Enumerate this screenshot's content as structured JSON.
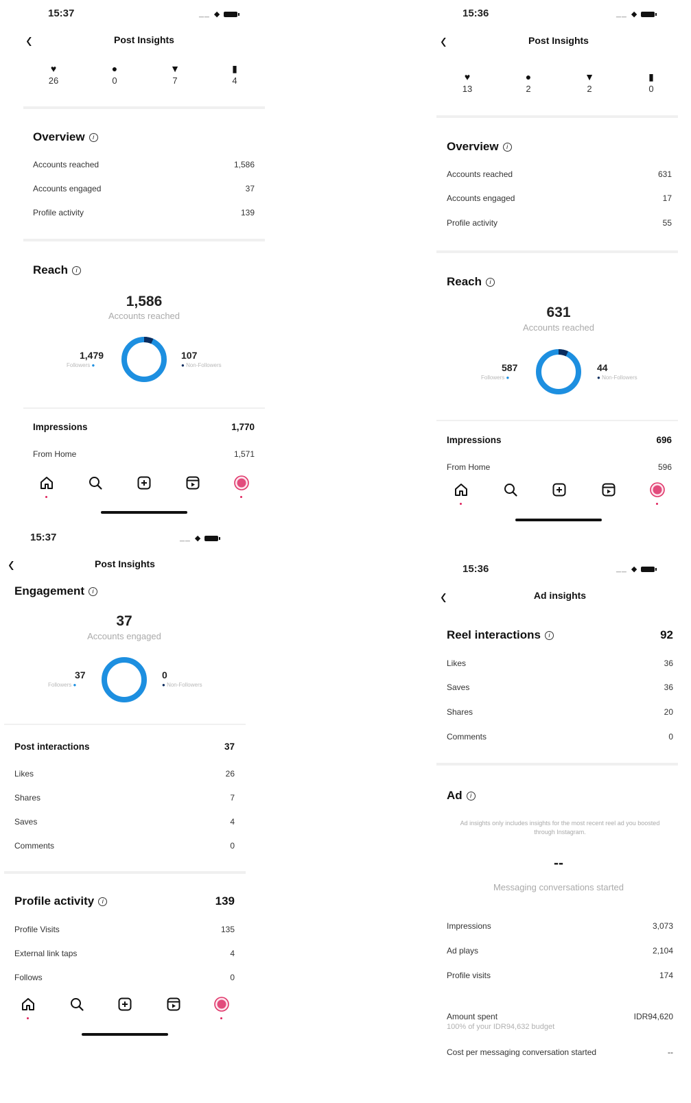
{
  "colors": {
    "accent": "#1d8fe0",
    "accent_dark": "#0c2d5e",
    "divider": "#f0f0f0"
  },
  "icons": [
    "heart-icon",
    "comment-icon",
    "share-icon",
    "bookmark-icon",
    "home-icon",
    "search-icon",
    "create-icon",
    "reels-icon",
    "avatar"
  ],
  "p1": {
    "time": "15:37",
    "title": "Post Insights",
    "stats": {
      "likes": "26",
      "comments": "0",
      "shares": "7",
      "saves": "4"
    },
    "overview": {
      "title": "Overview",
      "rows": [
        {
          "label": "Accounts reached",
          "value": "1,586"
        },
        {
          "label": "Accounts engaged",
          "value": "37"
        },
        {
          "label": "Profile activity",
          "value": "139"
        }
      ]
    },
    "reach": {
      "title": "Reach",
      "total": "1,586",
      "sub": "Accounts reached",
      "followers": "1,479",
      "followers_label": "Followers",
      "non_followers": "107",
      "non_followers_label": "Non-Followers",
      "non_follower_fraction": 0.067
    },
    "impressions": {
      "label": "Impressions",
      "value": "1,770"
    },
    "from_home": {
      "label": "From Home",
      "value": "1,571"
    }
  },
  "p2": {
    "time": "15:36",
    "title": "Post Insights",
    "stats": {
      "likes": "13",
      "comments": "2",
      "shares": "2",
      "saves": "0"
    },
    "overview": {
      "title": "Overview",
      "rows": [
        {
          "label": "Accounts reached",
          "value": "631"
        },
        {
          "label": "Accounts engaged",
          "value": "17"
        },
        {
          "label": "Profile activity",
          "value": "55"
        }
      ]
    },
    "reach": {
      "title": "Reach",
      "total": "631",
      "sub": "Accounts reached",
      "followers": "587",
      "followers_label": "Followers",
      "non_followers": "44",
      "non_followers_label": "Non-Followers",
      "non_follower_fraction": 0.07
    },
    "impressions": {
      "label": "Impressions",
      "value": "696"
    },
    "from_home": {
      "label": "From Home",
      "value": "596"
    }
  },
  "p3": {
    "time": "15:37",
    "title": "Post Insights",
    "engagement": {
      "title": "Engagement",
      "total": "37",
      "sub": "Accounts engaged",
      "followers": "37",
      "followers_label": "Followers",
      "non_followers": "0",
      "non_followers_label": "Non-Followers",
      "non_follower_fraction": 0
    },
    "post_interactions": {
      "label": "Post interactions",
      "value": "37",
      "rows": [
        {
          "label": "Likes",
          "value": "26"
        },
        {
          "label": "Shares",
          "value": "7"
        },
        {
          "label": "Saves",
          "value": "4"
        },
        {
          "label": "Comments",
          "value": "0"
        }
      ]
    },
    "profile_activity": {
      "label": "Profile activity",
      "value": "139",
      "rows": [
        {
          "label": "Profile Visits",
          "value": "135"
        },
        {
          "label": "External link taps",
          "value": "4"
        },
        {
          "label": "Follows",
          "value": "0"
        }
      ]
    }
  },
  "p4": {
    "time": "15:36",
    "title": "Ad insights",
    "reel_interactions": {
      "label": "Reel interactions",
      "value": "92",
      "rows": [
        {
          "label": "Likes",
          "value": "36"
        },
        {
          "label": "Saves",
          "value": "36"
        },
        {
          "label": "Shares",
          "value": "20"
        },
        {
          "label": "Comments",
          "value": "0"
        }
      ]
    },
    "ad": {
      "title": "Ad",
      "note": "Ad insights only includes insights for the most recent reel ad you boosted through Instagram.",
      "big": "--",
      "big_sub": "Messaging conversations started",
      "rows": [
        {
          "label": "Impressions",
          "value": "3,073"
        },
        {
          "label": "Ad plays",
          "value": "2,104"
        },
        {
          "label": "Profile visits",
          "value": "174"
        }
      ],
      "amount_label": "Amount spent",
      "amount_value": "IDR94,620",
      "amount_sub": "100% of your IDR94,632 budget",
      "cost_label": "Cost per messaging conversation started",
      "cost_value": "--"
    }
  }
}
